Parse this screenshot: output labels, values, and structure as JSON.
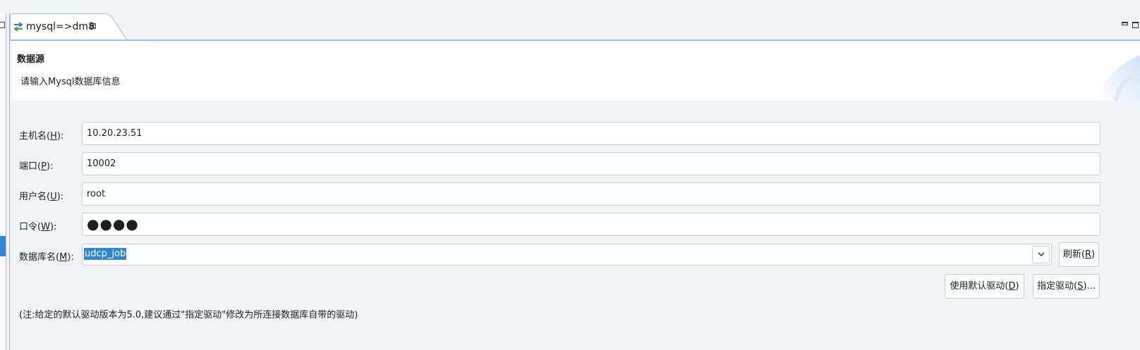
{
  "tab": {
    "title": "mysql=>dm8",
    "icon": "transfer-arrows-icon",
    "close_icon": "close-icon"
  },
  "header": {
    "title": "数据源",
    "description": "请输入Mysql数据库信息"
  },
  "form": {
    "host": {
      "label": "主机名(",
      "mnemonic": "H",
      "suffix": "):",
      "value": "10.20.23.51"
    },
    "port": {
      "label": "端口(",
      "mnemonic": "P",
      "suffix": "):",
      "value": "10002"
    },
    "user": {
      "label": "用户名(",
      "mnemonic": "U",
      "suffix": "):",
      "value": "root"
    },
    "password": {
      "label": "口令(",
      "mnemonic": "W",
      "suffix": "):",
      "value": "●●●●"
    },
    "database": {
      "label": "数据库名(",
      "mnemonic": "M",
      "suffix": "):",
      "value": "udcp_job"
    }
  },
  "buttons": {
    "refresh": {
      "label": "刷新(",
      "mnemonic": "R",
      "suffix": ")"
    },
    "default_driver": {
      "label": "使用默认驱动(",
      "mnemonic": "D",
      "suffix": ")"
    },
    "specify_driver": {
      "label": "指定驱动(",
      "mnemonic": "S",
      "suffix": ")..."
    }
  },
  "note": "(注:给定的默认驱动版本为5.0,建议通过\"指定驱动\"修改为所连接数据库自带的驱动)",
  "colors": {
    "accent": "#2f86d6",
    "tab_border": "#8ec3ee",
    "background": "#f2f3f5"
  }
}
